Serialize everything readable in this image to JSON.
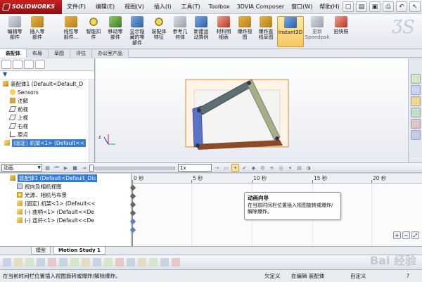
{
  "app": {
    "brand": "SOLIDWORKS"
  },
  "menu": [
    "文件(F)",
    "编辑(E)",
    "视图(V)",
    "插入(I)",
    "工具(T)",
    "Toolbox",
    "3DVIA Composer",
    "窗口(W)",
    "帮助(H)"
  ],
  "ribbon": {
    "commands": [
      {
        "label": "编辑零\n部件",
        "icon": "edit-component-icon"
      },
      {
        "label": "插入零\n部件",
        "icon": "insert-component-icon"
      },
      {
        "label": "线性零\n部件...",
        "icon": "linear-pattern-icon"
      },
      {
        "label": "智能扣\n件",
        "icon": "smart-fastener-icon"
      },
      {
        "label": "移动零\n部件",
        "icon": "move-component-icon"
      },
      {
        "label": "显示隐\n藏的零\n部件",
        "icon": "show-hidden-icon"
      },
      {
        "label": "装配体\n特征",
        "icon": "assembly-feature-icon"
      },
      {
        "label": "参考几\n何体",
        "icon": "reference-geometry-icon"
      },
      {
        "label": "新建运\n动算例",
        "icon": "new-motion-study-icon"
      },
      {
        "label": "材料明\n细表",
        "icon": "bom-icon"
      },
      {
        "label": "爆炸视\n图",
        "icon": "exploded-view-icon"
      },
      {
        "label": "爆炸直\n线草图",
        "icon": "explode-line-sketch-icon"
      },
      {
        "label": "Instant3D",
        "icon": "instant3d-icon"
      },
      {
        "label": "更新\nSpeedpak",
        "icon": "speedpak-icon"
      },
      {
        "label": "拍快照",
        "icon": "snapshot-icon"
      }
    ]
  },
  "tabs": [
    "装配体",
    "布局",
    "草图",
    "评估",
    "办公室产品"
  ],
  "feature_tree": {
    "filter": "▼",
    "items": [
      {
        "label": "装配体1  (Default<Default_D",
        "icon": "asm"
      },
      {
        "label": "Sensors",
        "icon": "sensor"
      },
      {
        "label": "注解",
        "icon": "ann"
      },
      {
        "label": "前视",
        "icon": "plane"
      },
      {
        "label": "上视",
        "icon": "plane"
      },
      {
        "label": "右视",
        "icon": "plane"
      },
      {
        "label": "原点",
        "icon": "origin"
      },
      {
        "label": "(固定) 机架<1> (Default<<",
        "icon": "cmp"
      }
    ]
  },
  "motion": {
    "study_type": "动画",
    "speed": "1x",
    "tree": [
      {
        "label": "装配体1  (Default<Default_Dis",
        "icon": "asm",
        "level": 0
      },
      {
        "label": "视向及相机视图",
        "icon": "cam",
        "level": 1
      },
      {
        "label": "光源、相机与布景",
        "icon": "light",
        "level": 1
      },
      {
        "label": "(固定) 机架<1> (Default<<",
        "icon": "cmp",
        "level": 1
      },
      {
        "label": "(-) 曲柄<1> (Default<<De",
        "icon": "cmp",
        "level": 1
      },
      {
        "label": "(-) 连杆<1> (Default<<De",
        "icon": "cmp",
        "level": 1
      }
    ],
    "ruler": [
      {
        "label": "0 秒"
      },
      {
        "label": "5 秒"
      },
      {
        "label": "10 秒"
      },
      {
        "label": "15 秒"
      },
      {
        "label": "20 秒"
      }
    ],
    "callout": {
      "title": "动画向导",
      "text": "在当前时间栏位置插入视图旋转或爆炸/解除爆炸。"
    }
  },
  "study_tabs": [
    "模型",
    "Motion Study 1"
  ],
  "status": {
    "message": "在当前时间栏位置插入视图旋转或爆炸/解除爆炸。",
    "constraint": "欠定义",
    "mode": "在编辑 装配体",
    "custom": "自定义"
  },
  "watermark": "Bai 经验",
  "colors": {
    "selection": "#3479d8",
    "brand_red": "#c62020",
    "instant3d_highlight": "#f6c862"
  }
}
